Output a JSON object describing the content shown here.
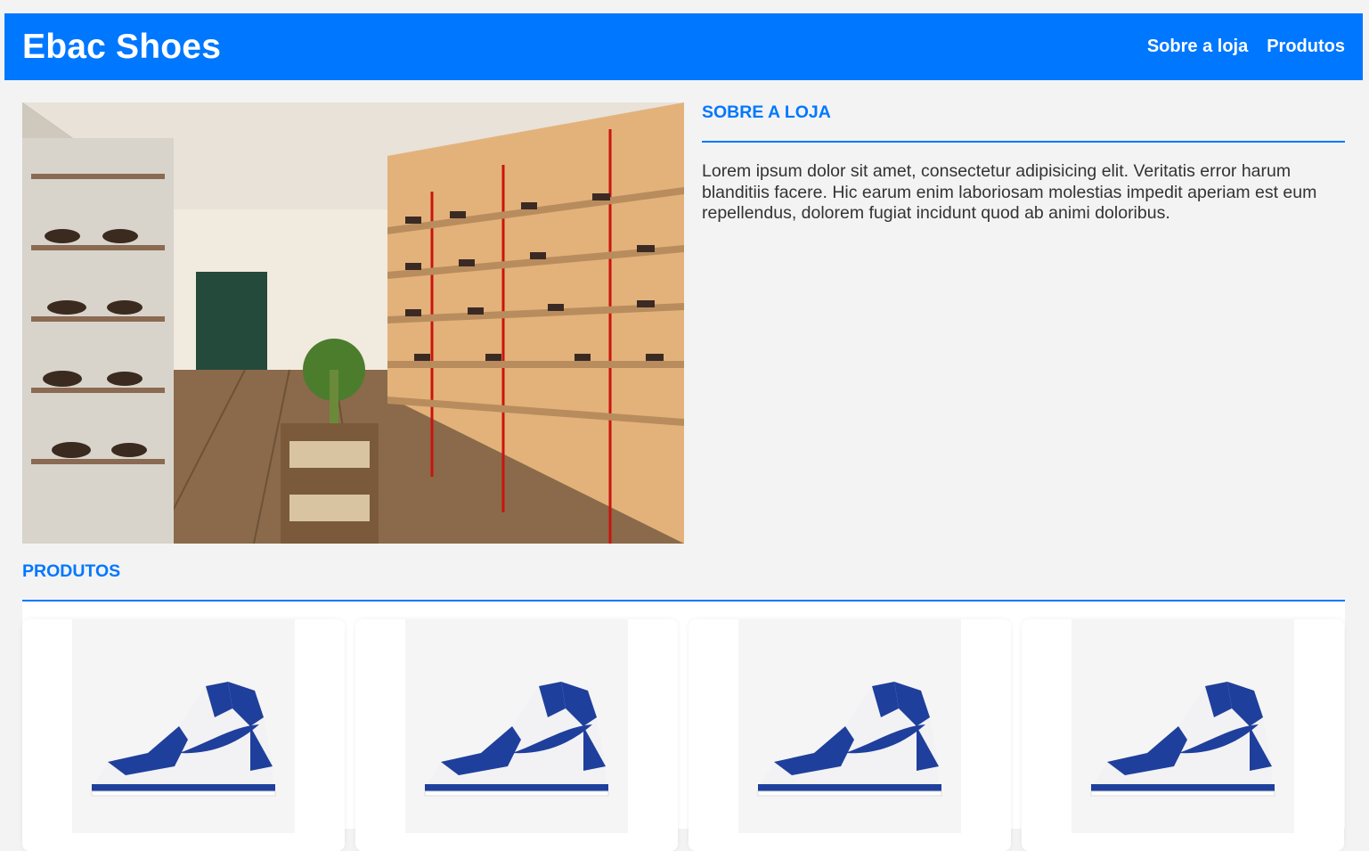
{
  "header": {
    "title": "Ebac Shoes",
    "nav": [
      "Sobre a loja",
      "Produtos"
    ]
  },
  "about": {
    "heading": "SOBRE A LOJA",
    "text": "Lorem ipsum dolor sit amet, consectetur adipisicing elit. Veritatis error harum blanditiis facere. Hic earum enim laboriosam molestias impedit aperiam est eum repellendus, dolorem fugiat incidunt quod ab animi doloribus."
  },
  "products": {
    "heading": "PRODUTOS",
    "items": [
      {
        "image": "blue-white-high-top-sneaker"
      },
      {
        "image": "blue-white-high-top-sneaker"
      },
      {
        "image": "blue-white-high-top-sneaker"
      },
      {
        "image": "blue-white-high-top-sneaker"
      }
    ]
  },
  "colors": {
    "primary": "#0077ff",
    "background": "#f3f3f3",
    "sneaker_blue": "#1f3f9c"
  }
}
